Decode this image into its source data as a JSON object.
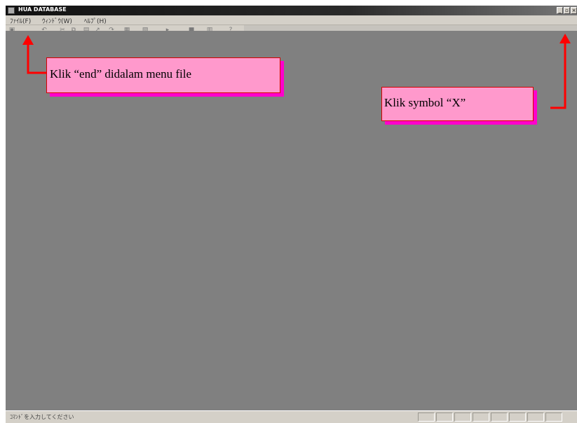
{
  "window": {
    "title": "HUA DATABASE",
    "controls": [
      "minimize",
      "restore",
      "close"
    ]
  },
  "menu": {
    "items": [
      {
        "label": "ﾌｧｲﾙ(F)"
      },
      {
        "label": "ｳｨﾝﾄﾞｳ(W)"
      },
      {
        "label": "ﾍﾙﾌﾟ(H)"
      }
    ]
  },
  "toolbar": {
    "buttons": [
      "save-icon",
      "undo-icon",
      "cut-icon",
      "copy-icon",
      "paste-icon",
      "cursor-icon",
      "redo-icon",
      "insert-icon",
      "format-icon",
      "run-icon",
      "stop-icon",
      "grid-icon",
      "help-icon"
    ]
  },
  "status": {
    "text": "ｺﾏﾝﾄﾞを入力してください"
  },
  "callouts": {
    "menu_file": "Klik “end” didalam menu file",
    "close": "Klik symbol “X”"
  },
  "colors": {
    "callout_fill": "#ff99cc",
    "callout_shadow": "#ff00cc",
    "arrow": "#ff0000",
    "workspace": "#808080"
  }
}
